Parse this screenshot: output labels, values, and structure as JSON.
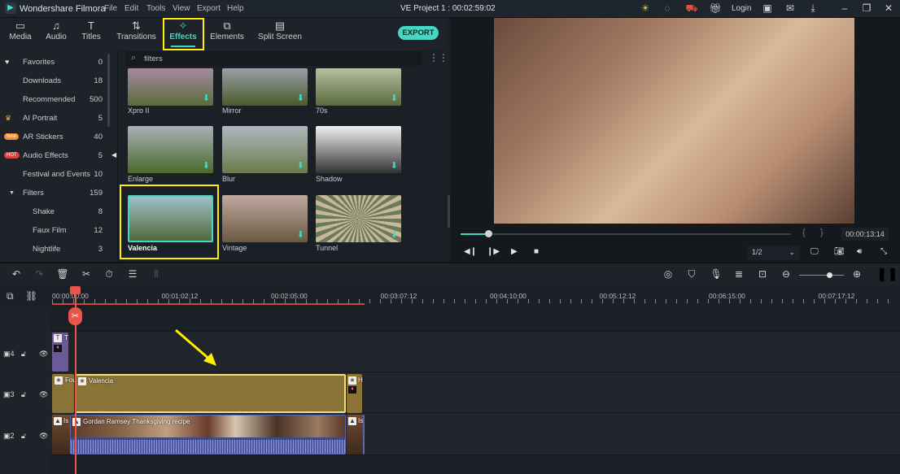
{
  "titlebar": {
    "app_name": "Wondershare Filmora",
    "menu": [
      "File",
      "Edit",
      "Tools",
      "View",
      "Export",
      "Help"
    ],
    "project": "VE Project 1 : 00:02:59:02",
    "login": "Login"
  },
  "tabs": [
    {
      "label": "Media",
      "icon": "folder-icon"
    },
    {
      "label": "Audio",
      "icon": "music-icon"
    },
    {
      "label": "Titles",
      "icon": "text-icon"
    },
    {
      "label": "Transitions",
      "icon": "transition-icon"
    },
    {
      "label": "Effects",
      "icon": "effects-icon",
      "active": true
    },
    {
      "label": "Elements",
      "icon": "elements-icon"
    },
    {
      "label": "Split Screen",
      "icon": "split-screen-icon"
    }
  ],
  "export_label": "EXPORT",
  "sidebar": {
    "items": [
      {
        "label": "Favorites",
        "count": "0",
        "icon": "heart-icon"
      },
      {
        "label": "Downloads",
        "count": "18"
      },
      {
        "label": "Recommended",
        "count": "500"
      },
      {
        "label": "AI Portrait",
        "count": "5",
        "icon": "crown-icon"
      },
      {
        "label": "AR Stickers",
        "count": "40",
        "badge": "New"
      },
      {
        "label": "Audio Effects",
        "count": "5",
        "badge": "HOT"
      },
      {
        "label": "Festival and Events",
        "count": "10"
      },
      {
        "label": "Filters",
        "count": "159",
        "icon": "triangle-down-icon"
      },
      {
        "label": "Shake",
        "count": "8",
        "sub": true
      },
      {
        "label": "Faux Film",
        "count": "12",
        "sub": true
      },
      {
        "label": "Nightlife",
        "count": "3",
        "sub": true
      }
    ]
  },
  "search": {
    "value": "filters"
  },
  "effects": [
    {
      "label": "Xpro II"
    },
    {
      "label": "Mirror"
    },
    {
      "label": "70s"
    },
    {
      "label": "Enlarge"
    },
    {
      "label": "Blur"
    },
    {
      "label": "Shadow"
    },
    {
      "label": "Valencia",
      "selected": true
    },
    {
      "label": "Vintage"
    },
    {
      "label": "Tunnel"
    }
  ],
  "player": {
    "time": "00:00:13:14",
    "progress_percent": 8,
    "ratio": "1/2",
    "brace_open": "{",
    "brace_close": "}"
  },
  "ruler": [
    "00:00:00:00",
    "00:01:02:12",
    "00:02:05:00",
    "00:03:07:12",
    "00:04:10:00",
    "00:05:12:12",
    "00:06:15:00",
    "00:07:17:12"
  ],
  "tracks": [
    {
      "label": "4"
    },
    {
      "label": "3"
    },
    {
      "label": "2"
    }
  ],
  "clips": {
    "title_clip": "T",
    "fx_clip_left": "Fou",
    "valencia": "Valencia",
    "video": "Gordan Ramsey Thanksgiving recipe",
    "video_left": "Is",
    "fx_right": "H",
    "vid_right": "Is"
  },
  "colors": {
    "accent": "#45d7c2",
    "highlight": "#ffef00",
    "playhead": "#e8554d",
    "effect_clip": "#8a7336",
    "video_clip": "#5a67b0"
  }
}
